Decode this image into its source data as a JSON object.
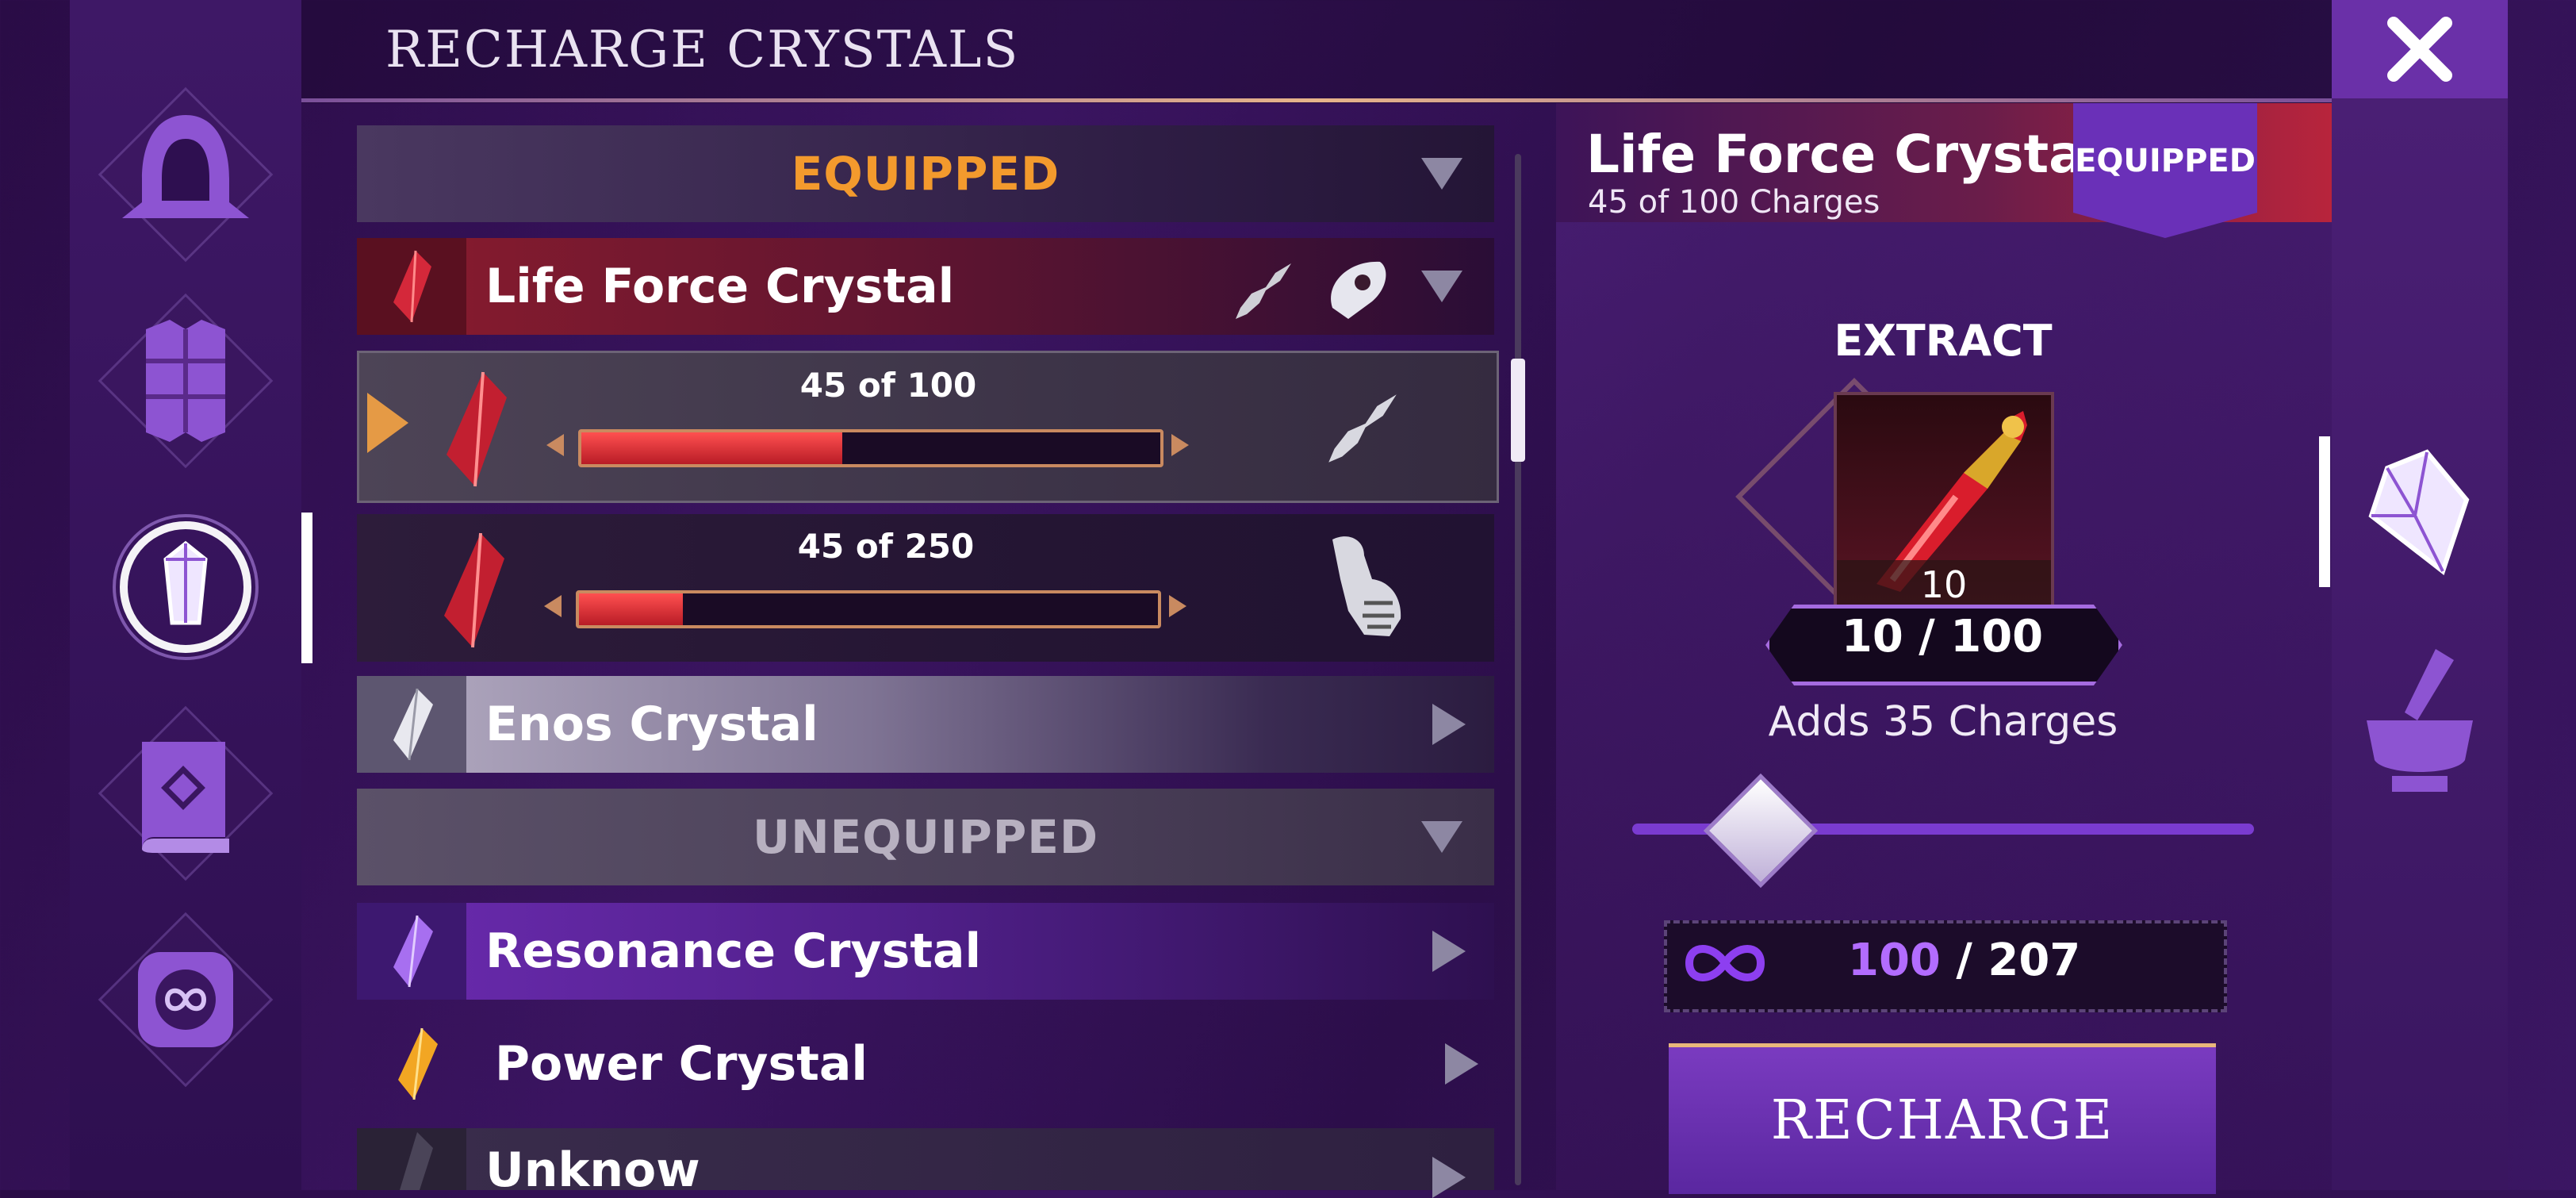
{
  "header": {
    "title": "RECHARGE CRYSTALS"
  },
  "nav": {
    "items": [
      "hood-icon",
      "armor-icon",
      "crystal-icon",
      "book-icon",
      "infinity-icon"
    ],
    "active": "crystal-icon"
  },
  "list": {
    "equipped_header": "EQUIPPED",
    "unequipped_header": "UNEQUIPPED",
    "life_force": {
      "name": "Life Force Crystal",
      "slots": [
        {
          "progress_label": "45 of 100",
          "fraction": 0.45,
          "gear_icon": "dagger-icon",
          "selected": true
        },
        {
          "progress_label": "45 of 250",
          "fraction": 0.18,
          "gear_icon": "gauntlet-icon",
          "selected": false
        }
      ]
    },
    "enos": {
      "name": "Enos Crystal"
    },
    "resonance": {
      "name": "Resonance Crystal"
    },
    "power": {
      "name": "Power Crystal"
    },
    "unknown": {
      "name": "Unknow"
    }
  },
  "detail": {
    "title": "Life Force Crystal",
    "subtitle": "45 of 100 Charges",
    "badge": "EQUIPPED",
    "extract_label": "EXTRACT",
    "item_count": "10",
    "item_ratio": "10 / 100",
    "adds_text": "Adds 35 Charges",
    "slider_fraction": 0.2,
    "currency_current": "100",
    "currency_total": "/ 207",
    "recharge_label": "RECHARGE"
  },
  "colors": {
    "accent_orange": "#f39a2d",
    "purple": "#7a3bc0",
    "red": "#c8202e"
  }
}
